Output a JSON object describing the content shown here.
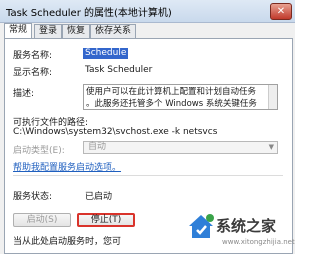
{
  "window": {
    "title": "Task Scheduler 的属性(本地计算机)",
    "close_glyph": "✕"
  },
  "tabs": [
    {
      "label": "常规",
      "active": true
    },
    {
      "label": "登录",
      "active": false
    },
    {
      "label": "恢复",
      "active": false
    },
    {
      "label": "依存关系",
      "active": false
    }
  ],
  "general": {
    "service_name_label": "服务名称:",
    "service_name_value": "Schedule",
    "display_name_label": "显示名称:",
    "display_name_value": "Task Scheduler",
    "description_label": "描述:",
    "description_line1": "使用户可以在此计算机上配置和计划自动任务",
    "description_line2": "。此服务还托管多个 Windows 系统关键任务",
    "path_label": "可执行文件的路径:",
    "path_value": "C:\\Windows\\system32\\svchost.exe -k netsvcs",
    "startup_type_label": "启动类型(E):",
    "startup_type_value": "自动",
    "help_link": "帮助我配置服务启动选项。",
    "service_status_label": "服务状态:",
    "service_status_value": "已启动",
    "start_button": "启动(S)",
    "stop_button": "停止(T)",
    "bottom_text": "当从此处启动服务时，您可"
  },
  "watermark": {
    "text": "系统之家",
    "url": "www.xitongzhijia.net",
    "colors": {
      "green": "#3aa34a",
      "blue": "#2f7fd8"
    }
  }
}
